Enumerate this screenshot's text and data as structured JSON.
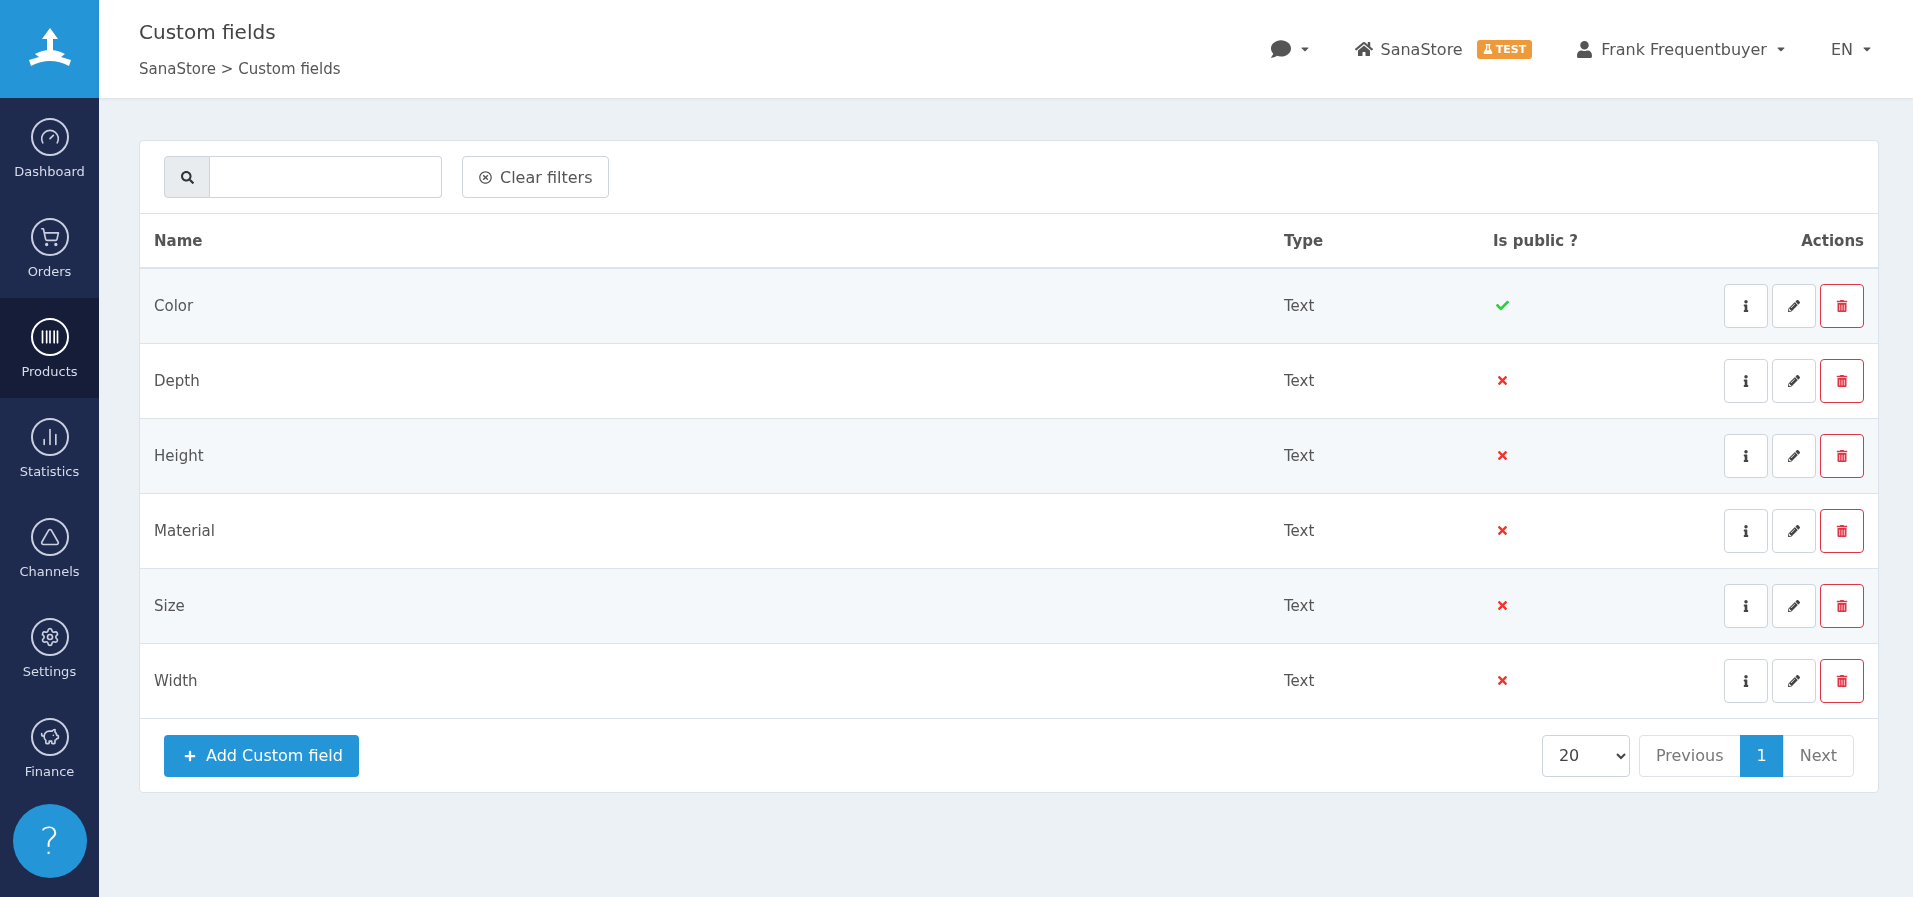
{
  "header": {
    "title": "Custom fields",
    "breadcrumb": "SanaStore > Custom fields",
    "store": "SanaStore",
    "env_badge": "TEST",
    "user": "Frank Frequentbuyer",
    "language": "EN"
  },
  "sidebar": {
    "items": [
      {
        "kind": "dashboard",
        "label": "Dashboard",
        "selected": false
      },
      {
        "kind": "orders",
        "label": "Orders",
        "selected": false
      },
      {
        "kind": "products",
        "label": "Products",
        "selected": true
      },
      {
        "kind": "statistics",
        "label": "Statistics",
        "selected": false
      },
      {
        "kind": "channels",
        "label": "Channels",
        "selected": false
      },
      {
        "kind": "settings",
        "label": "Settings",
        "selected": false
      },
      {
        "kind": "finance",
        "label": "Finance",
        "selected": false
      }
    ],
    "help": "?"
  },
  "filters": {
    "clear_label": "Clear filters"
  },
  "table": {
    "columns": [
      "Name",
      "Type",
      "Is public ?",
      "Actions"
    ],
    "rows": [
      {
        "name": "Color",
        "type": "Text",
        "is_public": true
      },
      {
        "name": "Depth",
        "type": "Text",
        "is_public": false
      },
      {
        "name": "Height",
        "type": "Text",
        "is_public": false
      },
      {
        "name": "Material",
        "type": "Text",
        "is_public": false
      },
      {
        "name": "Size",
        "type": "Text",
        "is_public": false
      },
      {
        "name": "Width",
        "type": "Text",
        "is_public": false
      }
    ]
  },
  "footer": {
    "add_label": "Add Custom field",
    "page_size": "20",
    "previous": "Previous",
    "pages": [
      {
        "label": "1",
        "selected": true
      }
    ],
    "next": "Next"
  }
}
